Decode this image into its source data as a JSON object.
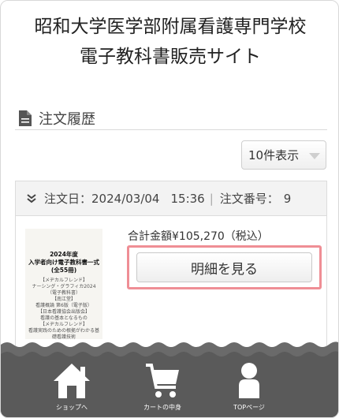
{
  "site": {
    "title_line1": "昭和大学医学部附属看護専門学校",
    "title_line2": "電子教科書販売サイト"
  },
  "section": {
    "title": "注文履歴",
    "icon": "document-icon"
  },
  "per_page": {
    "selected": "10件表示",
    "icon": "chevron-down-icon"
  },
  "order": {
    "date_label": "注文日：",
    "date": "2024/03/04",
    "time": "15:36",
    "separator": "|",
    "number_label": "注文番号：",
    "number": "9",
    "total_text": "合計金額¥105,270（税込）",
    "detail_button": "明細を見る",
    "cover": {
      "title1": "2024年度",
      "title2": "入学者向け電子教科書一式",
      "title3": "(全55冊)",
      "sub1": "【メヂカルフレンド】",
      "sub2": "ナーシング・グラフィカ2024（電子教科書）",
      "sub3": "【南江堂】",
      "sub4": "看護概論 第6版（電子版）",
      "sub5": "【日本看護協会出版会】",
      "sub6": "看護の基本となるもの",
      "sub7": "【メヂカルフレンド】",
      "sub8": "看護実践のための根拠がわかる基礎看護技術"
    }
  },
  "nav": {
    "items": [
      {
        "label": "ショップへ",
        "icon": "home-icon"
      },
      {
        "label": "カートの中身",
        "icon": "cart-icon"
      },
      {
        "label": "TOPページ",
        "icon": "person-icon"
      }
    ],
    "bar_color": "#5a5a5a"
  }
}
